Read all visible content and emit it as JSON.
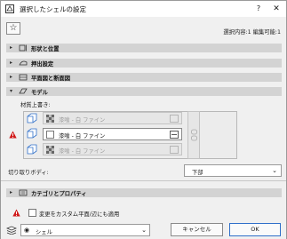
{
  "window": {
    "title": "選択したシェルの設定",
    "help": "?",
    "close": "✕"
  },
  "header": {
    "selection_info": "選択内容:1 編集可能:1"
  },
  "panels": [
    {
      "label": "形状と位置",
      "expanded": false
    },
    {
      "label": "押出設定",
      "expanded": false
    },
    {
      "label": "平面図と断面図",
      "expanded": false
    },
    {
      "label": "モデル",
      "expanded": true
    }
  ],
  "model": {
    "material_override_label": "材質上書き:",
    "rows": [
      {
        "name": "漆喰 - 白 ファイン",
        "active": false
      },
      {
        "name": "漆喰 - 白 ファイン",
        "active": true
      },
      {
        "name": "漆喰 - 白 ファイン",
        "active": false
      }
    ]
  },
  "cut": {
    "label": "切り取りボディ:",
    "value": "下部"
  },
  "category_panel": {
    "label": "カテゴリとプロパティ"
  },
  "custom_check": {
    "label": "変更をカスタム平面/辺にも適用",
    "checked": false
  },
  "bottom": {
    "layer": "シェル",
    "cancel": "キャンセル",
    "ok": "OK"
  },
  "colors": {
    "panel_bar": "#d3d3d3",
    "accent": "#2f6fc9",
    "warning": "#d01818"
  }
}
